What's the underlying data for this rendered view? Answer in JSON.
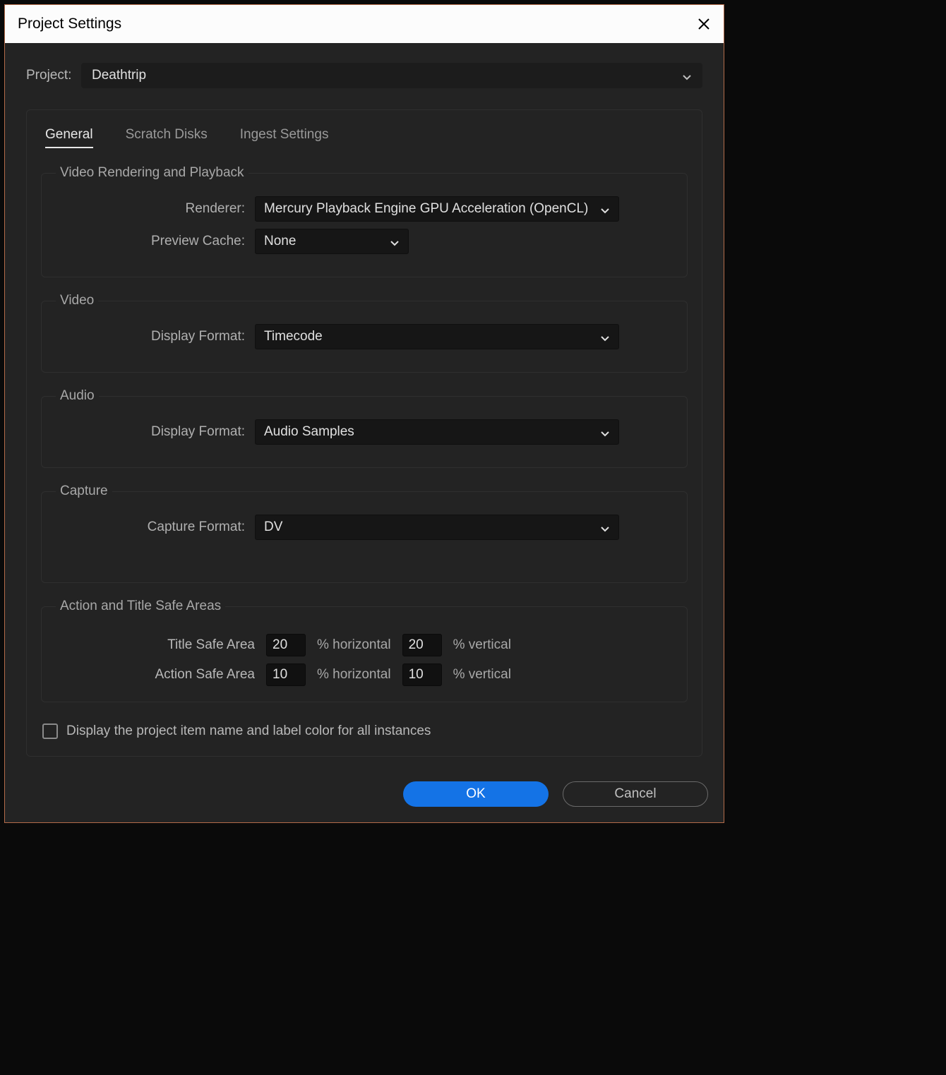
{
  "titlebar": {
    "title": "Project Settings"
  },
  "project": {
    "label": "Project:",
    "value": "Deathtrip"
  },
  "tabs": [
    {
      "label": "General",
      "active": true
    },
    {
      "label": "Scratch Disks",
      "active": false
    },
    {
      "label": "Ingest Settings",
      "active": false
    }
  ],
  "groups": {
    "rendering": {
      "legend": "Video Rendering and Playback",
      "renderer_label": "Renderer:",
      "renderer_value": "Mercury Playback Engine GPU Acceleration (OpenCL)",
      "preview_cache_label": "Preview Cache:",
      "preview_cache_value": "None"
    },
    "video": {
      "legend": "Video",
      "display_format_label": "Display Format:",
      "display_format_value": "Timecode"
    },
    "audio": {
      "legend": "Audio",
      "display_format_label": "Display Format:",
      "display_format_value": "Audio Samples"
    },
    "capture": {
      "legend": "Capture",
      "capture_format_label": "Capture Format:",
      "capture_format_value": "DV"
    },
    "safe_areas": {
      "legend": "Action and Title Safe Areas",
      "title_safe_label": "Title Safe Area",
      "title_h": "20",
      "title_v": "20",
      "action_safe_label": "Action Safe Area",
      "action_h": "10",
      "action_v": "10",
      "pct_horizontal": "% horizontal",
      "pct_vertical": "% vertical"
    }
  },
  "display_name_checkbox": {
    "label": "Display the project item name and label color for all instances",
    "checked": false
  },
  "footer": {
    "ok": "OK",
    "cancel": "Cancel"
  }
}
